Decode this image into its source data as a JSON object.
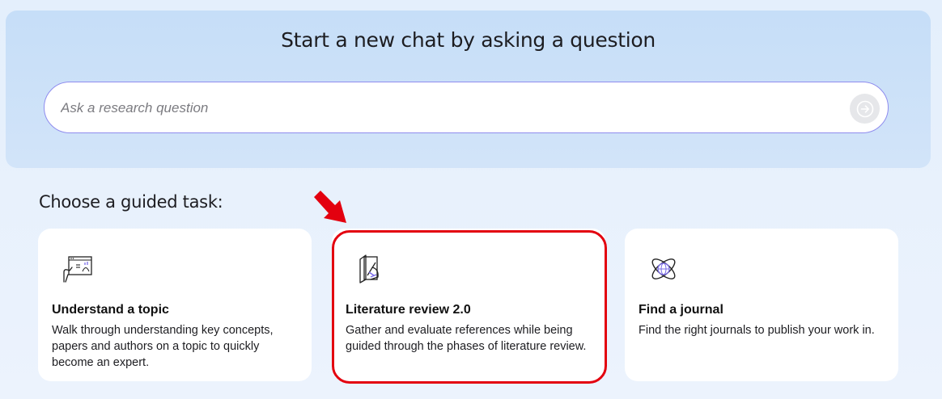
{
  "hero": {
    "title": "Start a new chat by asking a question",
    "search_placeholder": "Ask a research question",
    "search_value": "",
    "submit_icon": "arrow-right-icon"
  },
  "guided_tasks": {
    "heading": "Choose a guided task:",
    "cards": [
      {
        "title": "Understand a topic",
        "description": "Walk through understanding key concepts, papers and authors on a topic to quickly become an expert.",
        "icon": "topic-presentation-icon"
      },
      {
        "title": "Literature review 2.0",
        "description": "Gather and evaluate references while being guided through the phases of literature review.",
        "icon": "literature-review-icon"
      },
      {
        "title": "Find a journal",
        "description": "Find the right journals to publish your work in.",
        "icon": "journal-globe-icon"
      }
    ]
  },
  "annotation": {
    "highlight_color": "#e3000f",
    "pointer_icon": "red-arrow-icon"
  },
  "colors": {
    "accent_border": "#8f8cee",
    "hero_background": "#c6def8"
  }
}
